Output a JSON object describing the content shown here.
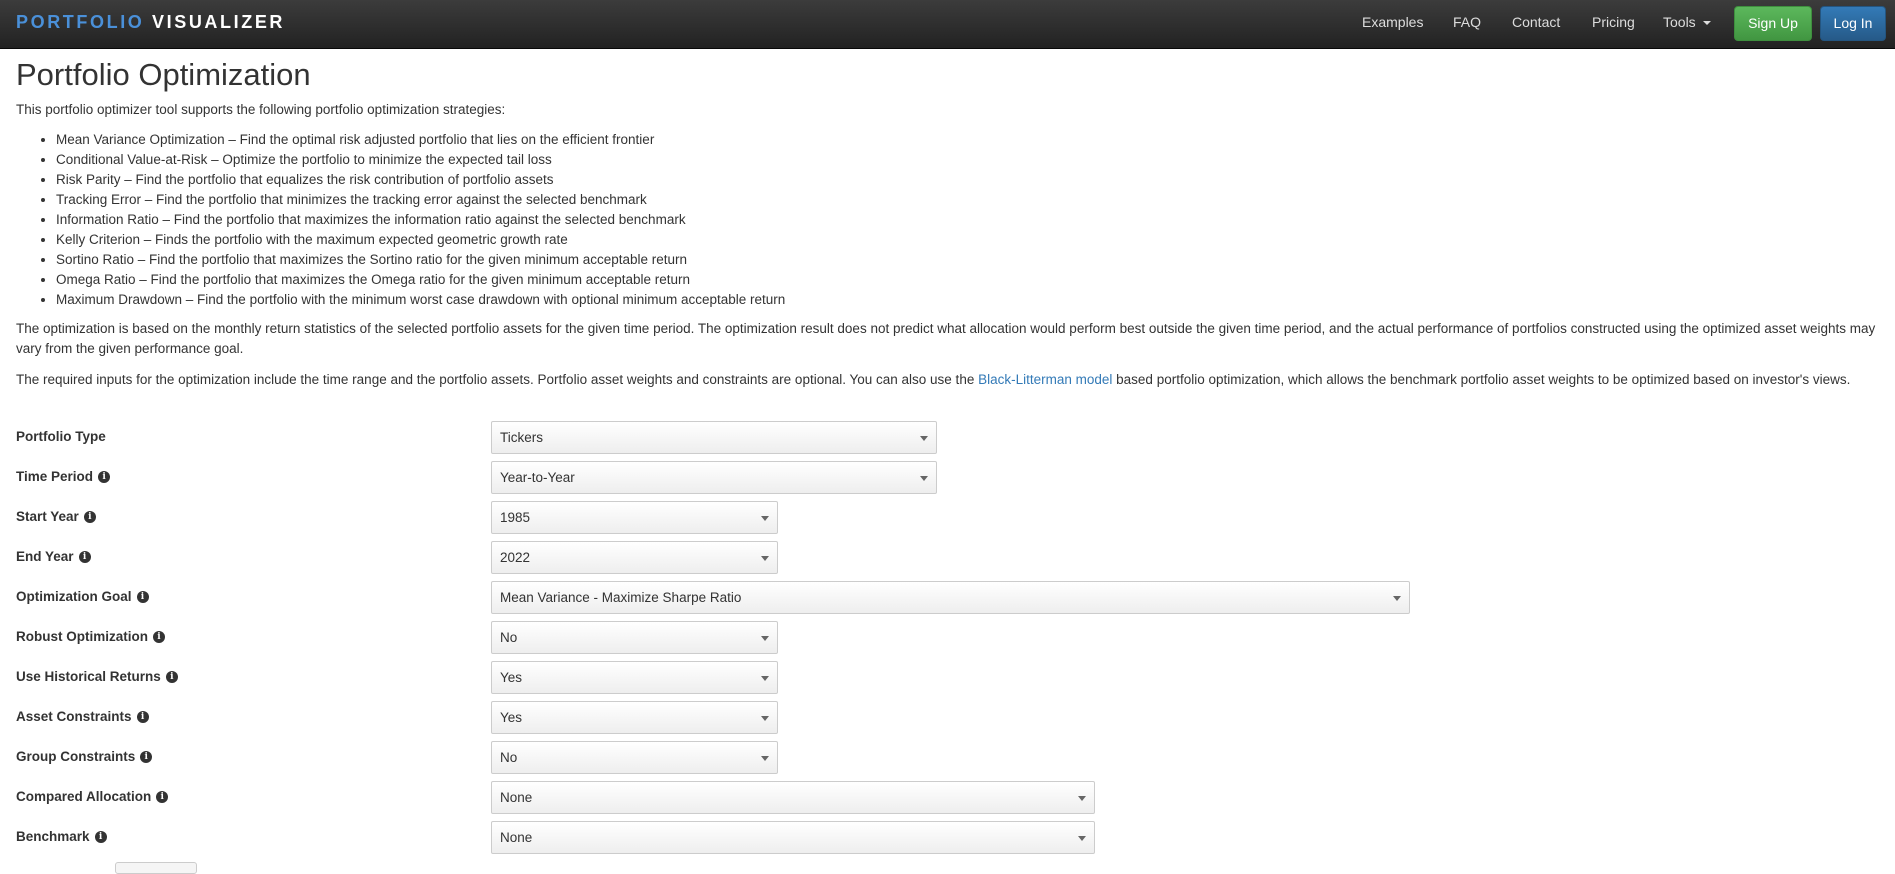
{
  "brand": {
    "part1": "PORTFOLIO",
    "part2": "VISUALIZER"
  },
  "nav": {
    "examples": "Examples",
    "faq": "FAQ",
    "contact": "Contact",
    "pricing": "Pricing",
    "tools": "Tools",
    "signup": "Sign Up",
    "login": "Log In"
  },
  "page": {
    "title": "Portfolio Optimization",
    "intro": "This portfolio optimizer tool supports the following portfolio optimization strategies:",
    "strategies": [
      "Mean Variance Optimization – Find the optimal risk adjusted portfolio that lies on the efficient frontier",
      "Conditional Value-at-Risk – Optimize the portfolio to minimize the expected tail loss",
      "Risk Parity – Find the portfolio that equalizes the risk contribution of portfolio assets",
      "Tracking Error – Find the portfolio that minimizes the tracking error against the selected benchmark",
      "Information Ratio – Find the portfolio that maximizes the information ratio against the selected benchmark",
      "Kelly Criterion – Finds the portfolio with the maximum expected geometric growth rate",
      "Sortino Ratio – Find the portfolio that maximizes the Sortino ratio for the given minimum acceptable return",
      "Omega Ratio – Find the portfolio that maximizes the Omega ratio for the given minimum acceptable return",
      "Maximum Drawdown – Find the portfolio with the minimum worst case drawdown with optional minimum acceptable return"
    ],
    "para1": "The optimization is based on the monthly return statistics of the selected portfolio assets for the given time period. The optimization result does not predict what allocation would perform best outside the given time period, and the actual performance of portfolios constructed using the optimized asset weights may vary from the given performance goal.",
    "para2_before": "The required inputs for the optimization include the time range and the portfolio assets. Portfolio asset weights and constraints are optional. You can also use the ",
    "para2_link": "Black-Litterman model",
    "para2_after": " based portfolio optimization, which allows the benchmark portfolio asset weights to be optimized based on investor's views."
  },
  "form": {
    "portfolio_type": {
      "label": "Portfolio Type",
      "value": "Tickers"
    },
    "time_period": {
      "label": "Time Period",
      "value": "Year-to-Year"
    },
    "start_year": {
      "label": "Start Year",
      "value": "1985"
    },
    "end_year": {
      "label": "End Year",
      "value": "2022"
    },
    "optimization_goal": {
      "label": "Optimization Goal",
      "value": "Mean Variance - Maximize Sharpe Ratio"
    },
    "robust_optimization": {
      "label": "Robust Optimization",
      "value": "No"
    },
    "historical_returns": {
      "label": "Use Historical Returns",
      "value": "Yes"
    },
    "asset_constraints": {
      "label": "Asset Constraints",
      "value": "Yes"
    },
    "group_constraints": {
      "label": "Group Constraints",
      "value": "No"
    },
    "compared_allocation": {
      "label": "Compared Allocation",
      "value": "None"
    },
    "benchmark": {
      "label": "Benchmark",
      "value": "None"
    }
  },
  "icons": {
    "info": "info-icon",
    "dropdown": "chevron-down-icon"
  },
  "colors": {
    "brand_blue": "#4a90d9",
    "signup_green": "#5cb85c",
    "login_blue": "#337ab7",
    "link": "#337ab7"
  }
}
